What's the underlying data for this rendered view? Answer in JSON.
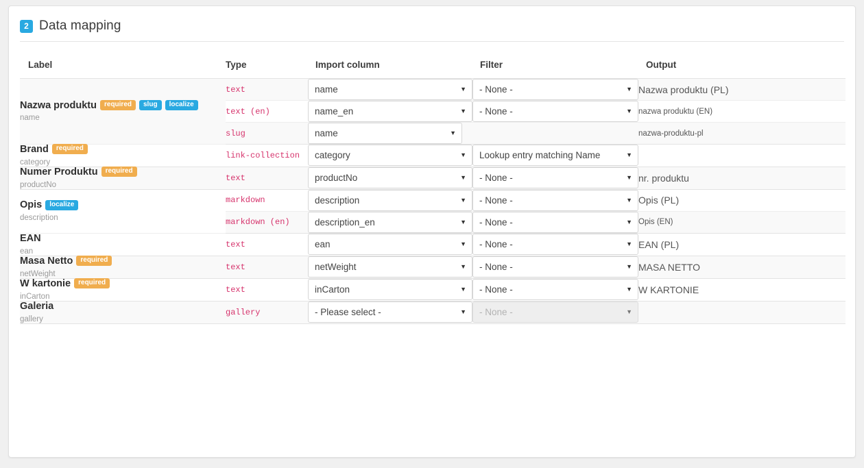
{
  "header": {
    "step_number": "2",
    "title": "Data mapping"
  },
  "table": {
    "columns": {
      "label": "Label",
      "type": "Type",
      "import_column": "Import column",
      "filter": "Filter",
      "output": "Output"
    }
  },
  "fields": [
    {
      "label": "Nazwa produktu",
      "machine_name": "name",
      "tags": [
        "required",
        "slug",
        "localize"
      ],
      "rows": [
        {
          "type": "text",
          "import": "name",
          "filter": "- None -",
          "output": "Nazwa produktu (PL)",
          "output_size": "lg"
        },
        {
          "type": "text (en)",
          "import": "name_en",
          "filter": "- None -",
          "output": "nazwa produktu (EN)",
          "output_size": "sm"
        },
        {
          "type": "slug",
          "import": "name",
          "filter": "",
          "output": "nazwa-produktu-pl",
          "output_size": "sm",
          "import_narrow": true,
          "filter_hidden": true
        }
      ]
    },
    {
      "label": "Brand",
      "machine_name": "category",
      "tags": [
        "required"
      ],
      "rows": [
        {
          "type": "link-collection",
          "import": "category",
          "filter": "Lookup entry matching Name",
          "output": "",
          "output_size": "lg"
        }
      ]
    },
    {
      "label": "Numer Produktu",
      "machine_name": "productNo",
      "tags": [
        "required"
      ],
      "rows": [
        {
          "type": "text",
          "import": "productNo",
          "filter": "- None -",
          "output": "nr. produktu",
          "output_size": "lg"
        }
      ]
    },
    {
      "label": "Opis",
      "machine_name": "description",
      "tags": [
        "localize"
      ],
      "rows": [
        {
          "type": "markdown",
          "import": "description",
          "filter": "- None -",
          "output": "Opis (PL)",
          "output_size": "lg"
        },
        {
          "type": "markdown (en)",
          "import": "description_en",
          "filter": "- None -",
          "output": "Opis (EN)",
          "output_size": "sm"
        }
      ]
    },
    {
      "label": "EAN",
      "machine_name": "ean",
      "tags": [],
      "rows": [
        {
          "type": "text",
          "import": "ean",
          "filter": "- None -",
          "output": "EAN (PL)",
          "output_size": "lg"
        }
      ]
    },
    {
      "label": "Masa Netto",
      "machine_name": "netWeight",
      "tags": [
        "required"
      ],
      "rows": [
        {
          "type": "text",
          "import": "netWeight",
          "filter": "- None -",
          "output": "MASA NETTO",
          "output_size": "lg"
        }
      ]
    },
    {
      "label": "W kartonie",
      "machine_name": "inCarton",
      "tags": [
        "required"
      ],
      "rows": [
        {
          "type": "text",
          "import": "inCarton",
          "filter": "- None -",
          "output": "W KARTONIE",
          "output_size": "lg"
        }
      ]
    },
    {
      "label": "Galeria",
      "machine_name": "gallery",
      "tags": [],
      "rows": [
        {
          "type": "gallery",
          "import": "- Please select -",
          "filter": "- None -",
          "output": "",
          "output_size": "lg",
          "filter_disabled": true
        }
      ]
    }
  ],
  "icons": {
    "caret_down": "▼"
  },
  "colors": {
    "accent_blue": "#29a9e1",
    "required_orange": "#f0ad4e",
    "type_pink": "#d6336c",
    "row_alt": "#f9f9f9"
  }
}
